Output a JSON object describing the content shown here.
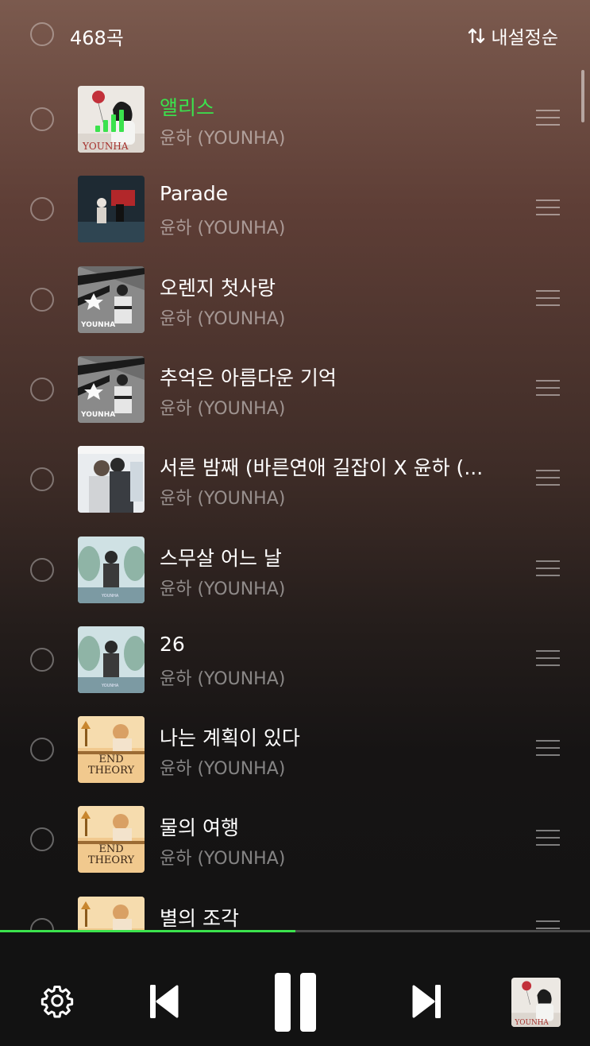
{
  "header": {
    "track_count": "468곡",
    "sort_label": "내설정순"
  },
  "now_playing_index": 0,
  "tracks": [
    {
      "title": "앨리스",
      "artist": "윤하 (YOUNHA)",
      "cover": "cover-alice",
      "playing": true
    },
    {
      "title": "Parade",
      "artist": "윤하 (YOUNHA)",
      "cover": "cover-parade",
      "playing": false
    },
    {
      "title": "오렌지 첫사랑",
      "artist": "윤하 (YOUNHA)",
      "cover": "cover-unstable",
      "playing": false
    },
    {
      "title": "추억은 아름다운 기억",
      "artist": "윤하 (YOUNHA)",
      "cover": "cover-unstable",
      "playing": false
    },
    {
      "title": "서른 밤째 (바른연애 길잡이 X 윤하 (...",
      "artist": "윤하 (YOUNHA)",
      "cover": "cover-ost",
      "playing": false
    },
    {
      "title": "스무살 어느 날",
      "artist": "윤하 (YOUNHA)",
      "cover": "cover-teal",
      "playing": false
    },
    {
      "title": "26",
      "artist": "윤하 (YOUNHA)",
      "cover": "cover-teal",
      "playing": false
    },
    {
      "title": "나는 계획이 있다",
      "artist": "윤하 (YOUNHA)",
      "cover": "cover-endtheory",
      "playing": false
    },
    {
      "title": "물의 여행",
      "artist": "윤하 (YOUNHA)",
      "cover": "cover-endtheory",
      "playing": false
    },
    {
      "title": "별의 조각",
      "artist": "윤하 (YOUNHA)",
      "cover": "cover-endtheory",
      "playing": false
    }
  ],
  "cover_text": {
    "younha": "YOUNHA",
    "end_theory_1": "END",
    "end_theory_2": "THEORY"
  },
  "playback": {
    "progress_fraction": 0.5
  },
  "controls": {
    "settings_icon": "gear-icon",
    "prev_icon": "skip-previous-icon",
    "play_icon": "pause-icon",
    "next_icon": "skip-next-icon",
    "mini_cover_icon": "album-thumbnail"
  },
  "colors": {
    "accent": "#3be24d"
  }
}
